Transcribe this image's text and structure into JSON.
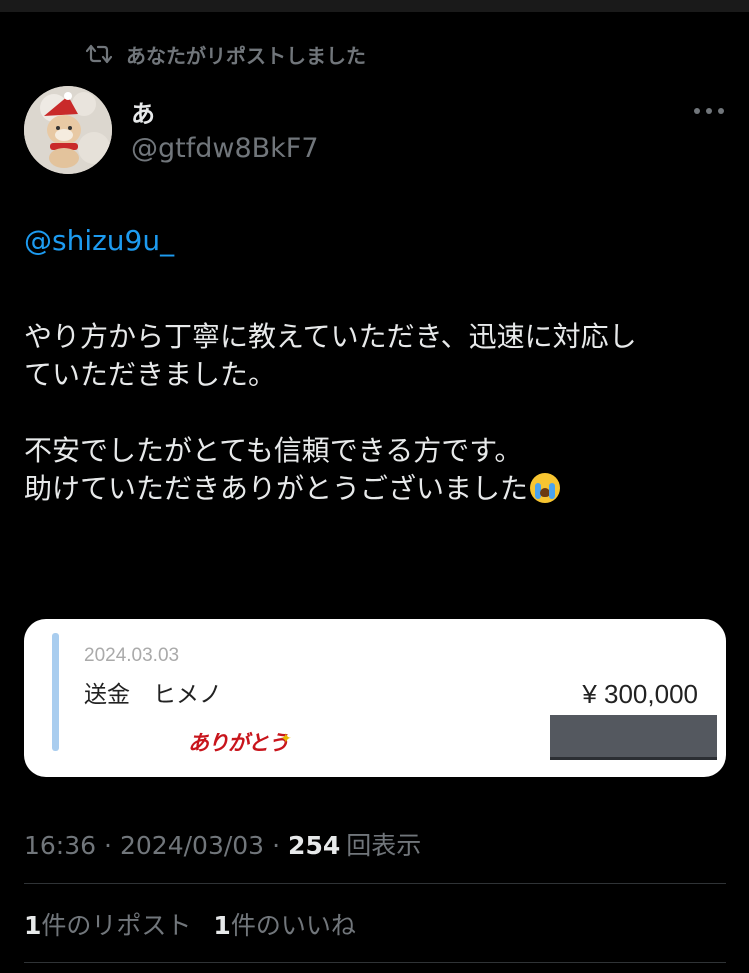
{
  "retweet_header": {
    "text": "あなたがリポストしました"
  },
  "author": {
    "display_name": "あ",
    "handle": "@gtfdw8BkF7"
  },
  "tweet": {
    "mention": "@shizu9u_",
    "paragraph_1": "やり方から丁寧に教えていただき、迅速に対応し\nていただきました。",
    "paragraph_2": "不安でしたがとても信頼できる方です。\n助けていただきありがとうございました",
    "emoji": "loudly-crying-face"
  },
  "attachment_card": {
    "date": "2024.03.03",
    "label": "送金　ヒメノ",
    "amount": "¥ 300,000",
    "stamp": "ありがとう"
  },
  "meta": {
    "time": "16:36",
    "date": "2024/03/03",
    "separator": "·",
    "views_count": "254",
    "views_label": "回表示"
  },
  "engagement": {
    "reposts_count": "1",
    "reposts_label": "件のリポスト",
    "likes_count": "1",
    "likes_label": "件のいいね"
  },
  "colors": {
    "background": "#000000",
    "text": "#e7e9ea",
    "muted": "#71767b",
    "link": "#1d9bf0",
    "card": "#ffffff",
    "card_bar": "#a9cdef",
    "stamp": "#c8151c"
  }
}
